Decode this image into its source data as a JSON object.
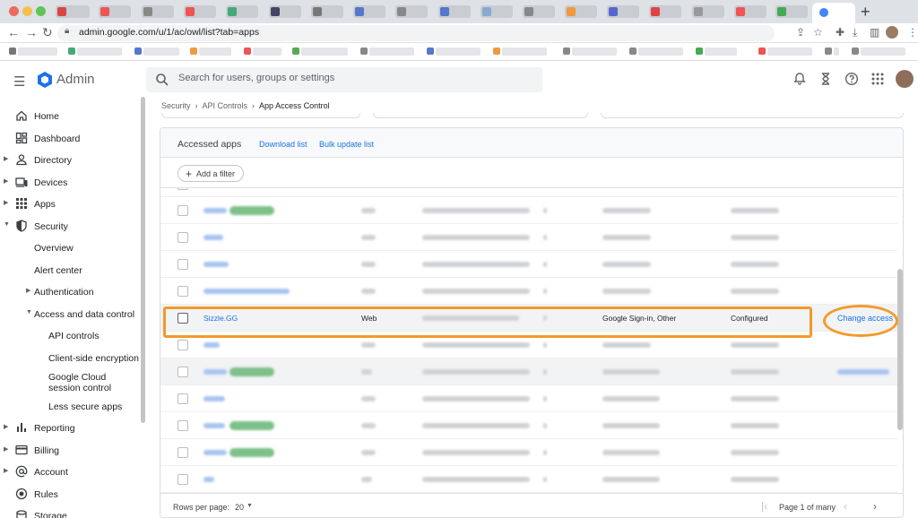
{
  "browser": {
    "url": "admin.google.com/u/1/ac/owl/list?tab=apps",
    "traffic_colors": [
      "#ed6a5e",
      "#f5bf4f",
      "#61c554"
    ]
  },
  "app": {
    "name": "Admin",
    "search_placeholder": "Search for users, groups or settings"
  },
  "sidebar": {
    "items": [
      {
        "label": "Home",
        "icon": "home-icon"
      },
      {
        "label": "Dashboard",
        "icon": "dashboard-icon"
      },
      {
        "label": "Directory",
        "icon": "person-icon"
      },
      {
        "label": "Devices",
        "icon": "devices-icon"
      },
      {
        "label": "Apps",
        "icon": "apps-grid-icon"
      },
      {
        "label": "Security",
        "icon": "shield-icon"
      },
      {
        "label": "Overview"
      },
      {
        "label": "Alert center"
      },
      {
        "label": "Authentication"
      },
      {
        "label": "Access and data control"
      },
      {
        "label": "API controls"
      },
      {
        "label": "Client-side encryption"
      },
      {
        "label": "Google Cloud session control"
      },
      {
        "label": "Less secure apps"
      },
      {
        "label": "Reporting",
        "icon": "bar-chart-icon"
      },
      {
        "label": "Billing",
        "icon": "credit-card-icon"
      },
      {
        "label": "Account",
        "icon": "at-sign-icon"
      },
      {
        "label": "Rules",
        "icon": "rules-icon"
      },
      {
        "label": "Storage",
        "icon": "storage-icon"
      }
    ]
  },
  "breadcrumb": {
    "items": [
      "Security",
      "API Controls"
    ],
    "current": "App Access Control"
  },
  "card": {
    "title": "Accessed apps",
    "download_label": "Download list",
    "bulk_label": "Bulk update list",
    "add_filter_label": "Add a filter"
  },
  "selected_row": {
    "name": "Sizzle.GG",
    "type": "Web",
    "verification": "Google Sign-in, Other",
    "access": "Configured",
    "action": "Change access"
  },
  "footer": {
    "rows_per_page_label": "Rows per page:",
    "rows_per_page_value": "20",
    "page_label": "Page 1 of many"
  },
  "colors": {
    "accent": "#1a73e8",
    "highlight": "#f39a2a",
    "verified_badge": "#188038"
  }
}
